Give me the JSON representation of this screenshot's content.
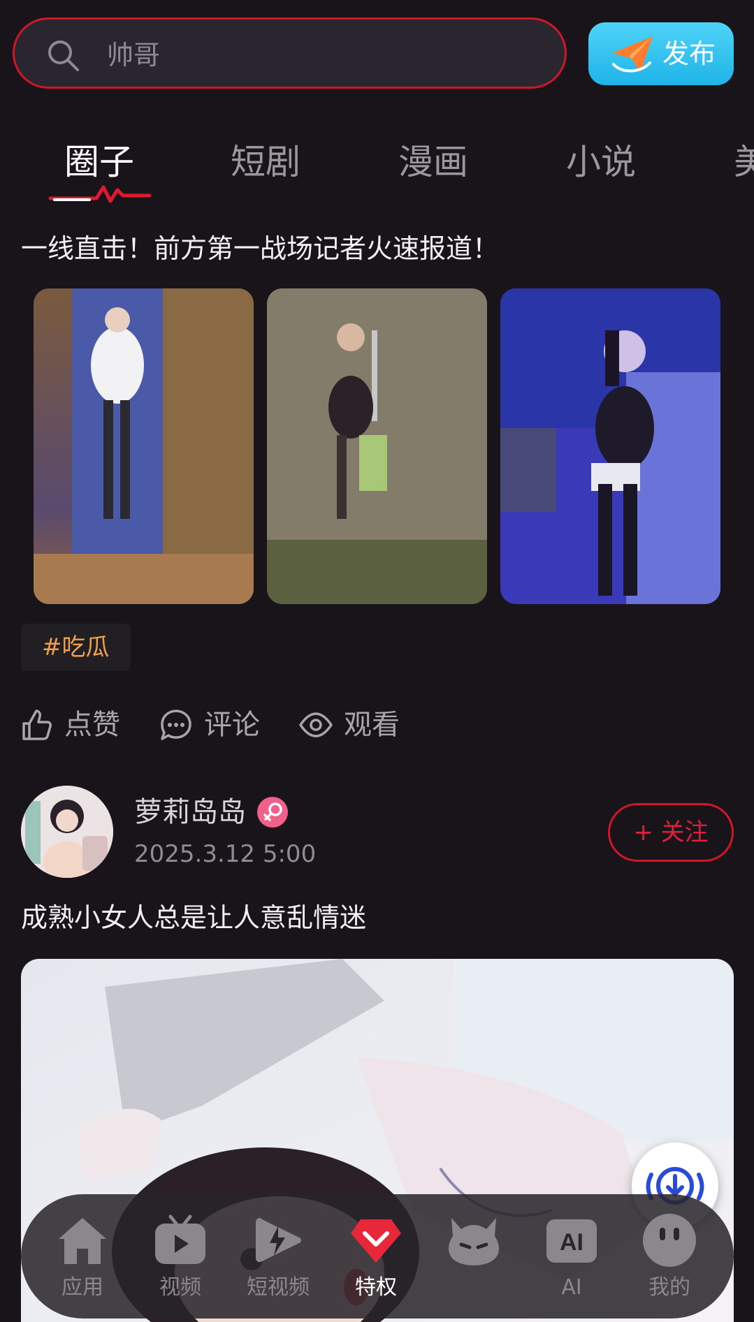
{
  "search": {
    "placeholder": "帅哥"
  },
  "publish": {
    "label": "发布"
  },
  "tabs": [
    {
      "label": "圈子",
      "active": true
    },
    {
      "label": "短剧",
      "active": false
    },
    {
      "label": "漫画",
      "active": false
    },
    {
      "label": "小说",
      "active": false
    },
    {
      "label": "美",
      "active": false
    }
  ],
  "post1": {
    "text": "一线直击！前方第一战场记者火速报道！",
    "tag": "#吃瓜",
    "actions": {
      "like": "点赞",
      "comment": "评论",
      "view": "观看"
    }
  },
  "post2": {
    "author": "萝莉岛岛",
    "avatar_text": "萝莉岛岛",
    "time": "2025.3.12 5:00",
    "follow": "+ 关注",
    "text": "成熟小女人总是让人意乱情迷"
  },
  "nav": [
    {
      "label": "应用",
      "icon": "home-icon",
      "active": false
    },
    {
      "label": "视频",
      "icon": "tv-icon",
      "active": false
    },
    {
      "label": "短视频",
      "icon": "lightning-play-icon",
      "active": false
    },
    {
      "label": "特权",
      "icon": "diamond-icon",
      "active": true
    },
    {
      "label": "",
      "icon": "devil-icon",
      "active": false
    },
    {
      "label": "AI",
      "icon": "ai-icon",
      "active": false
    },
    {
      "label": "我的",
      "icon": "profile-icon",
      "active": false
    }
  ],
  "colors": {
    "background": "#18141a",
    "accent_red": "#d01628",
    "publish_blue": "#1fb4e8",
    "tag_orange": "#f0a04b",
    "gender_pink": "#f0608a"
  }
}
